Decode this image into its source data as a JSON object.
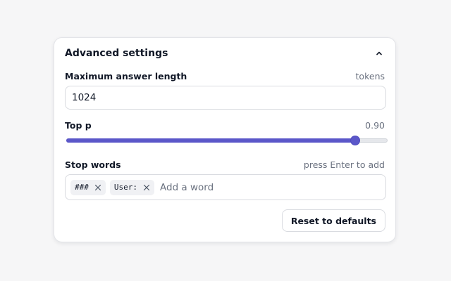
{
  "panel": {
    "title": "Advanced settings",
    "collapse_icon": "chevron-up-icon"
  },
  "max_length": {
    "label": "Maximum answer length",
    "unit": "tokens",
    "value": "1024"
  },
  "top_p": {
    "label": "Top p",
    "value_text": "0.90",
    "value": 0.9,
    "min": 0,
    "max": 1
  },
  "stop_words": {
    "label": "Stop words",
    "hint": "press Enter to add",
    "tags": [
      {
        "text": "###"
      },
      {
        "text": "User:"
      }
    ],
    "placeholder": "Add a word",
    "remove_icon": "close-icon"
  },
  "reset_button": {
    "label": "Reset to defaults"
  },
  "colors": {
    "accent": "#5b57c9",
    "border": "#d9dbe0",
    "background": "#f6f6f7"
  }
}
